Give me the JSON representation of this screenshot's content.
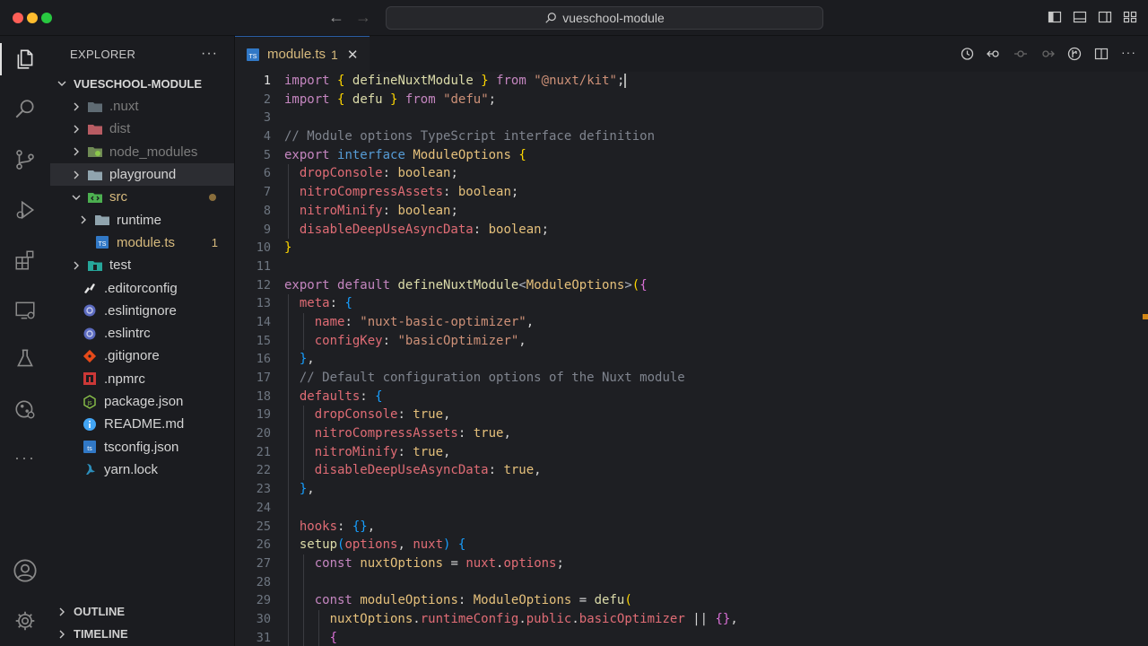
{
  "window": {
    "search_text": "vueschool-module"
  },
  "explorer": {
    "title": "EXPLORER",
    "more": "···",
    "root": "VUESCHOOL-MODULE",
    "items": [
      {
        "label": ".nuxt"
      },
      {
        "label": "dist"
      },
      {
        "label": "node_modules"
      },
      {
        "label": "playground"
      },
      {
        "label": "src"
      },
      {
        "label": "runtime"
      },
      {
        "label": "module.ts",
        "badge": "1"
      },
      {
        "label": "test"
      },
      {
        "label": ".editorconfig"
      },
      {
        "label": ".eslintignore"
      },
      {
        "label": ".eslintrc"
      },
      {
        "label": ".gitignore"
      },
      {
        "label": ".npmrc"
      },
      {
        "label": "package.json"
      },
      {
        "label": "README.md"
      },
      {
        "label": "tsconfig.json"
      },
      {
        "label": "yarn.lock"
      }
    ],
    "outline": "OUTLINE",
    "timeline": "TIMELINE"
  },
  "tab": {
    "label": "module.ts",
    "badge": "1",
    "close": "✕",
    "icon_text": "TS"
  },
  "editor": {
    "line_numbers": [
      "1",
      "2",
      "3",
      "4",
      "5",
      "6",
      "7",
      "8",
      "9",
      "10",
      "11",
      "12",
      "13",
      "14",
      "15",
      "16",
      "17",
      "18",
      "19",
      "20",
      "21",
      "22",
      "23",
      "24",
      "25",
      "26",
      "27",
      "28",
      "29",
      "30",
      "31"
    ],
    "tokens": {
      "import": "import",
      "from": "from",
      "export": "export",
      "interface": "interface",
      "default": "default",
      "const": "const",
      "defineNuxtModule": "defineNuxtModule",
      "defu": "defu",
      "kit_path": "\"@nuxt/kit\"",
      "defu_path": "\"defu\"",
      "comment1": "// Module options TypeScript interface definition",
      "ModuleOptions": "ModuleOptions",
      "dropConsole": "dropConsole",
      "nitroCompressAssets": "nitroCompressAssets",
      "nitroMinify": "nitroMinify",
      "disableDeepUseAsyncData": "disableDeepUseAsyncData",
      "boolean": "boolean",
      "meta": "meta",
      "name": "name",
      "name_value": "\"nuxt-basic-optimizer\"",
      "configKey": "configKey",
      "configKey_value": "\"basicOptimizer\"",
      "comment2": "// Default configuration options of the Nuxt module",
      "defaults": "defaults",
      "true": "true",
      "hooks": "hooks",
      "setup": "setup",
      "options": "options",
      "nuxt": "nuxt",
      "nuxtOptions": "nuxtOptions",
      "moduleOptions": "moduleOptions",
      "runtimeConfig": "runtimeConfig",
      "public": "public",
      "basicOptimizer": "basicOptimizer"
    }
  }
}
